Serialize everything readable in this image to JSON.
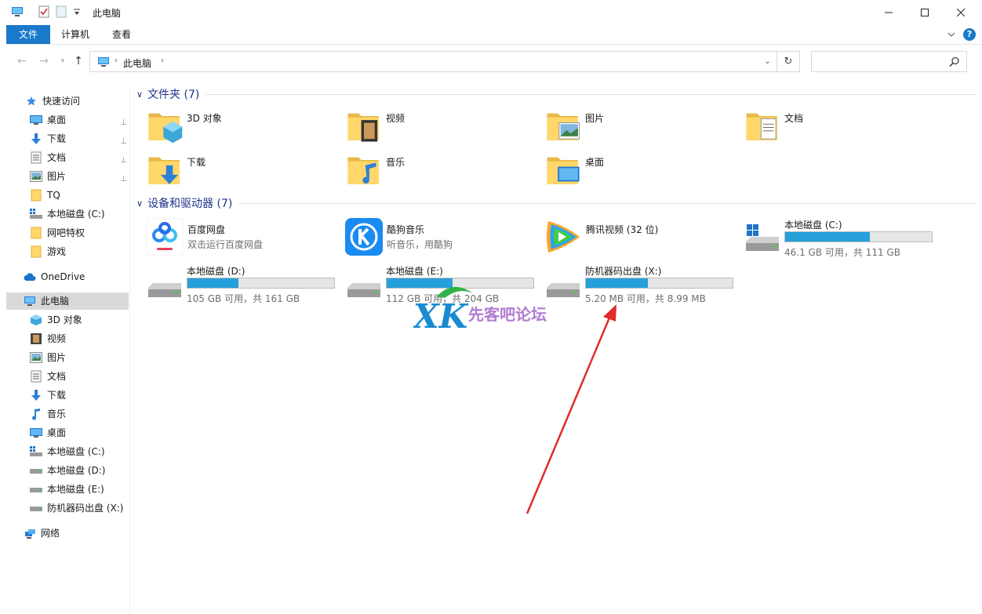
{
  "window": {
    "title": "此电脑",
    "tabs": [
      "文件",
      "计算机",
      "查看"
    ]
  },
  "address": {
    "path": "此电脑",
    "search_placeholder": ""
  },
  "sidebar": {
    "quick_access": "快速访问",
    "qa_items": [
      "桌面",
      "下载",
      "文档",
      "图片",
      "TQ",
      "本地磁盘 (C:)",
      "网吧特权",
      "游戏"
    ],
    "onedrive": "OneDrive",
    "this_pc": "此电脑",
    "pc_items": [
      "3D 对象",
      "视频",
      "图片",
      "文档",
      "下载",
      "音乐",
      "桌面",
      "本地磁盘 (C:)",
      "本地磁盘 (D:)",
      "本地磁盘 (E:)",
      "防机器码出盘 (X:)"
    ],
    "network": "网络"
  },
  "folders": {
    "header": "文件夹 (7)",
    "items": [
      "3D 对象",
      "视频",
      "图片",
      "文档",
      "下载",
      "音乐",
      "桌面"
    ]
  },
  "devices": {
    "header": "设备和驱动器 (7)",
    "apps": [
      {
        "name": "百度网盘",
        "desc": "双击运行百度网盘"
      },
      {
        "name": "酷狗音乐",
        "desc": "听音乐，用酷狗"
      },
      {
        "name": "腾讯视频 (32 位)",
        "desc": ""
      }
    ],
    "drives": [
      {
        "name": "本地磁盘 (C:)",
        "info": "46.1 GB 可用，共 111 GB",
        "used": 0.58
      },
      {
        "name": "本地磁盘 (D:)",
        "info": "105 GB 可用，共 161 GB",
        "used": 0.35
      },
      {
        "name": "本地磁盘 (E:)",
        "info": "112 GB 可用，共 204 GB",
        "used": 0.45
      },
      {
        "name": "防机器码出盘 (X:)",
        "info": "5.20 MB 可用，共 8.99 MB",
        "used": 0.42
      }
    ]
  },
  "watermark": {
    "logo": "XK",
    "text": "先客吧论坛"
  },
  "colors": {
    "accent": "#1979ca",
    "bar": "#26a0da",
    "group_header": "#1e3287",
    "arrow": "#e02b2b"
  }
}
